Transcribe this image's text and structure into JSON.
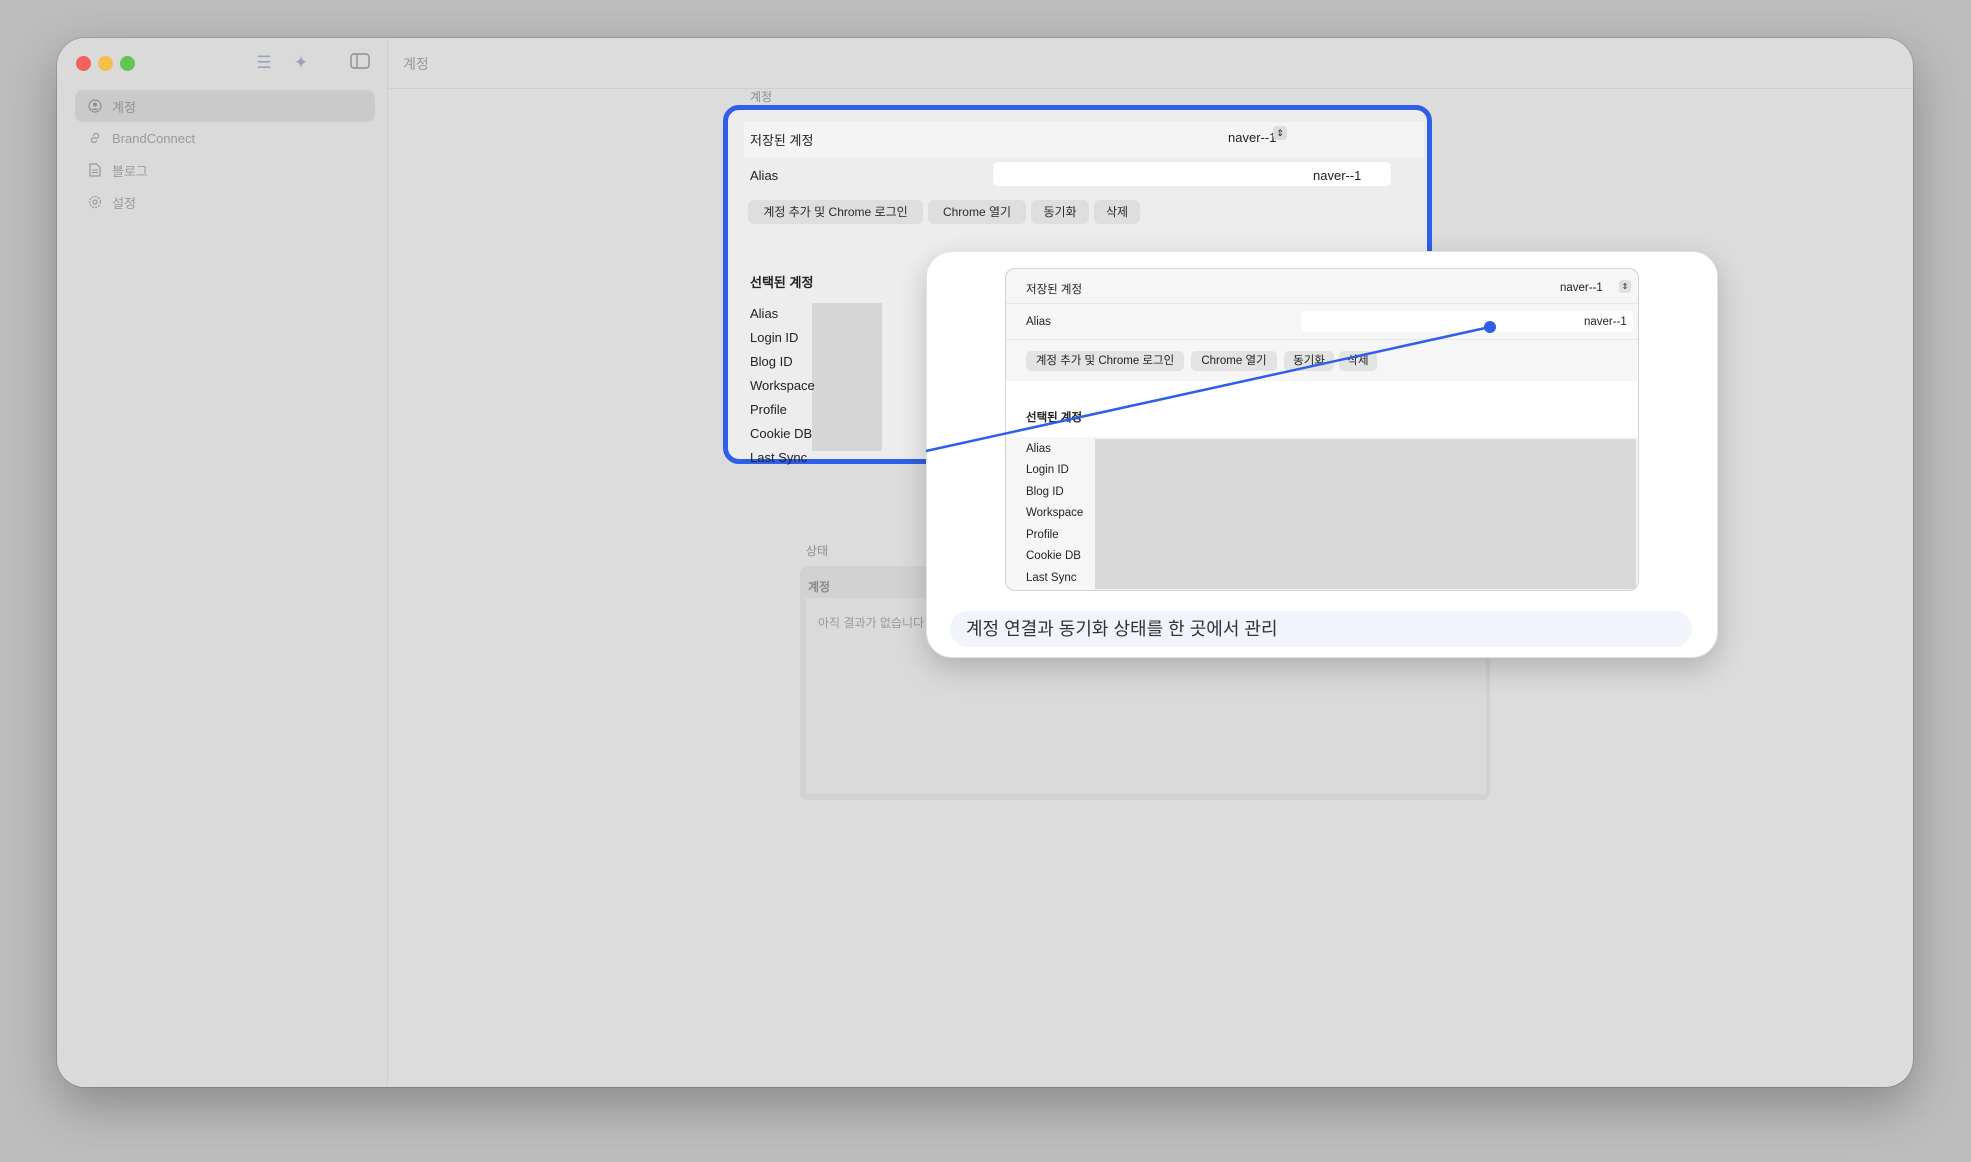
{
  "window": {
    "title": "계정"
  },
  "toolbar": {
    "icons": [
      "list-icon",
      "sparkle-icon",
      "sidebar-toggle-icon"
    ]
  },
  "sidebar": {
    "items": [
      {
        "label": "계정",
        "icon": "person-circle-icon",
        "selected": true
      },
      {
        "label": "BrandConnect",
        "icon": "link-icon",
        "selected": false
      },
      {
        "label": "블로그",
        "icon": "document-icon",
        "selected": false
      },
      {
        "label": "설정",
        "icon": "gear-icon",
        "selected": false
      }
    ]
  },
  "main": {
    "section_account": "계정",
    "saved_account_label": "저장된 계정",
    "saved_account_value": "naver--1",
    "alias_label": "Alias",
    "alias_value": "naver--1",
    "buttons": [
      "계정 추가 및 Chrome 로그인",
      "Chrome 열기",
      "동기화",
      "삭제"
    ],
    "selected_heading": "선택된 계정",
    "fields": [
      "Alias",
      "Login ID",
      "Blog ID",
      "Workspace",
      "Profile",
      "Cookie DB",
      "Last Sync"
    ],
    "status_section": "상태",
    "status_subsection": "계정",
    "status_empty": "아직 결과가 없습니다"
  },
  "popup": {
    "saved_account_label": "저장된 계정",
    "saved_account_value": "naver--1",
    "alias_label": "Alias",
    "alias_value": "naver--1",
    "buttons": [
      "계정 추가 및 Chrome 로그인",
      "Chrome 열기",
      "동기화",
      "삭제"
    ],
    "selected_heading": "선택된 계정",
    "fields": [
      "Alias",
      "Login ID",
      "Blog ID",
      "Workspace",
      "Profile",
      "Cookie DB",
      "Last Sync"
    ],
    "caption": "계정 연결과 동기화 상태를 한 곳에서 관리"
  },
  "colors": {
    "accent": "#2f5ee8",
    "background": "#bdbdbd"
  }
}
